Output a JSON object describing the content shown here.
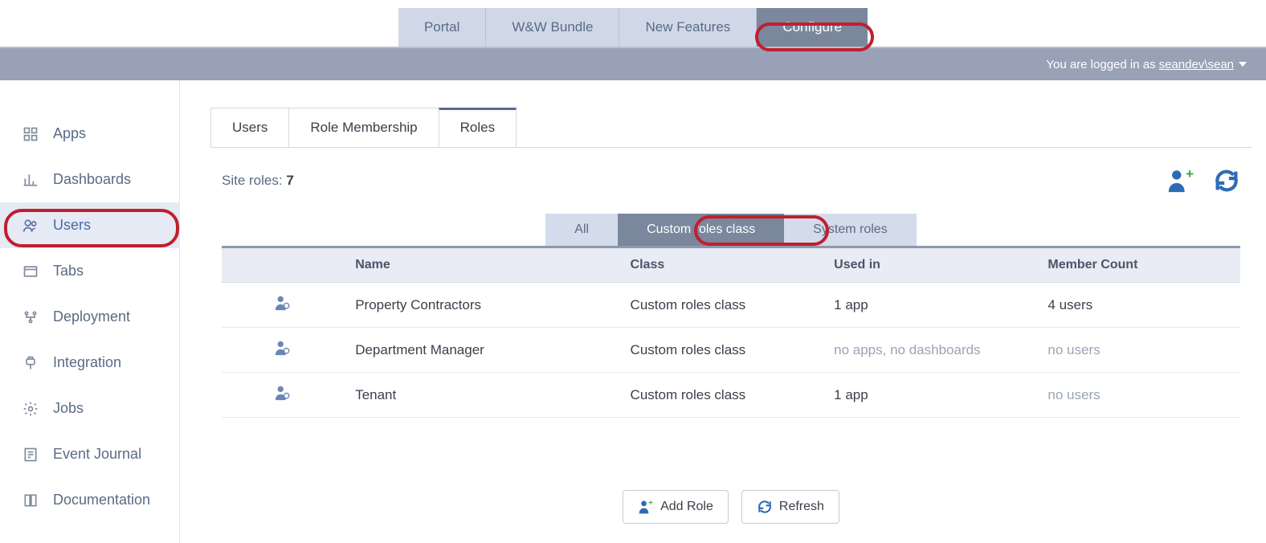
{
  "topnav": {
    "portal": "Portal",
    "bundle": "W&W Bundle",
    "features": "New Features",
    "configure": "Configure"
  },
  "userbar": {
    "prefix": "You are logged in as ",
    "user": "seandev\\sean"
  },
  "sidebar": {
    "apps": "Apps",
    "dashboards": "Dashboards",
    "users": "Users",
    "tabs": "Tabs",
    "deployment": "Deployment",
    "integration": "Integration",
    "jobs": "Jobs",
    "eventjournal": "Event Journal",
    "documentation": "Documentation"
  },
  "maintabs": {
    "users": "Users",
    "rolemembership": "Role Membership",
    "roles": "Roles"
  },
  "card": {
    "siteRolesLabel": "Site roles: ",
    "siteRolesCount": "7"
  },
  "filters": {
    "all": "All",
    "custom": "Custom roles class",
    "system": "System roles"
  },
  "table": {
    "headers": {
      "name": "Name",
      "class": "Class",
      "usedin": "Used in",
      "membercount": "Member Count"
    },
    "rows": [
      {
        "name": "Property Contractors",
        "class": "Custom roles class",
        "usedin": "1 app",
        "usedin_dim": false,
        "membercount": "4 users",
        "membercount_dim": false
      },
      {
        "name": "Department Manager",
        "class": "Custom roles class",
        "usedin": "no apps, no dashboards",
        "usedin_dim": true,
        "membercount": "no users",
        "membercount_dim": true
      },
      {
        "name": "Tenant",
        "class": "Custom roles class",
        "usedin": "1 app",
        "usedin_dim": false,
        "membercount": "no users",
        "membercount_dim": true
      }
    ]
  },
  "buttons": {
    "addrole": "Add Role",
    "refresh": "Refresh"
  }
}
